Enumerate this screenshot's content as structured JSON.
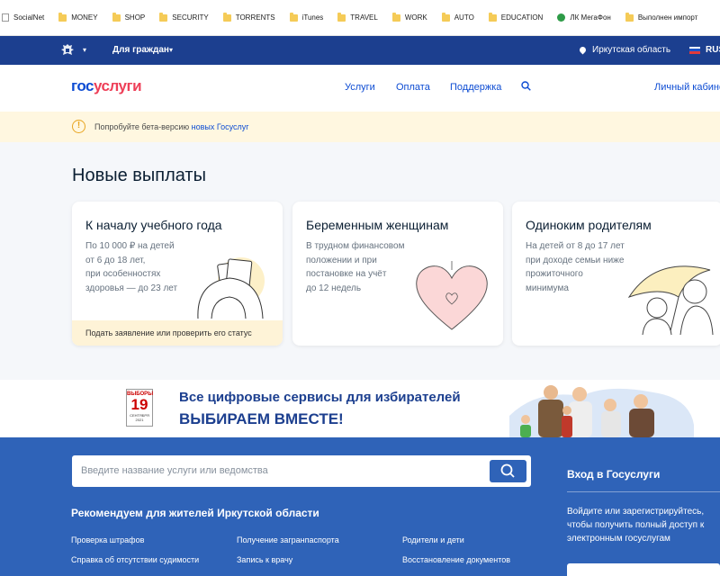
{
  "bookmarks": [
    {
      "icon": "page-icon",
      "label": "SocialNet"
    },
    {
      "icon": "folder-icon",
      "label": "MONEY"
    },
    {
      "icon": "folder-icon",
      "label": "SHOP"
    },
    {
      "icon": "folder-icon",
      "label": "SECURITY"
    },
    {
      "icon": "folder-icon",
      "label": "TORRENTS"
    },
    {
      "icon": "folder-icon",
      "label": "iTunes"
    },
    {
      "icon": "folder-icon",
      "label": "TRAVEL"
    },
    {
      "icon": "folder-icon",
      "label": "WORK"
    },
    {
      "icon": "folder-icon",
      "label": "AUTO"
    },
    {
      "icon": "folder-icon",
      "label": "EDUCATION"
    },
    {
      "icon": "megafon-icon",
      "label": "ЛК МегаФон"
    },
    {
      "icon": "folder-icon",
      "label": "Выполнен импорт"
    }
  ],
  "topbar": {
    "citizens": "Для граждан",
    "region": "Иркутская область",
    "lang": "RUS"
  },
  "header": {
    "logo_part1": "гос",
    "logo_part2": "услуги",
    "nav": [
      "Услуги",
      "Оплата",
      "Поддержка"
    ],
    "cabinet": "Личный кабинет"
  },
  "beta": {
    "text": "Попробуйте бета-версию ",
    "link": "новых Госуслуг"
  },
  "payments": {
    "title": "Новые выплаты",
    "cards": [
      {
        "title": "К началу учебного года",
        "lines": [
          "По 10 000 ₽ на детей",
          "от 6 до 18 лет,",
          "при особенностях",
          "здоровья — до 23 лет"
        ],
        "footer": "Подать заявление или проверить его статус"
      },
      {
        "title": "Беременным женщинам",
        "lines": [
          "В трудном финансовом",
          "положении и при",
          "постановке на учёт",
          "до 12 недель"
        ]
      },
      {
        "title": "Одиноким родителям",
        "lines": [
          "На детей от 8 до 17 лет",
          "при доходе семьи ниже",
          "прожиточного",
          "минимума"
        ]
      }
    ]
  },
  "election": {
    "cal_top": "ВЫБОРЫ",
    "cal_day": "19",
    "cal_month": "СЕНТЯБРЯ",
    "cal_year": "2021",
    "line1": "Все цифровые сервисы для избирателей",
    "line2": "ВЫБИРАЕМ ВМЕСТЕ!"
  },
  "search": {
    "placeholder": "Введите название услуги или ведомства"
  },
  "recommend": {
    "title": "Рекомендуем для жителей Иркутской области",
    "links": [
      "Проверка штрафов",
      "Получение загранпаспорта",
      "Родители и дети",
      "Справка об отсутствии судимости",
      "Запись к врачу",
      "Восстановление документов"
    ]
  },
  "login": {
    "title": "Вход в Госуслуги",
    "desc": "Войдите или зарегистрируйтесь, чтобы получить полный доступ к электронным госуслугам"
  },
  "colors": {
    "primary": "#0d4cd3",
    "topbar": "#1c3f8f",
    "search_bg": "#2f63b8",
    "accent": "#ee3f58"
  }
}
